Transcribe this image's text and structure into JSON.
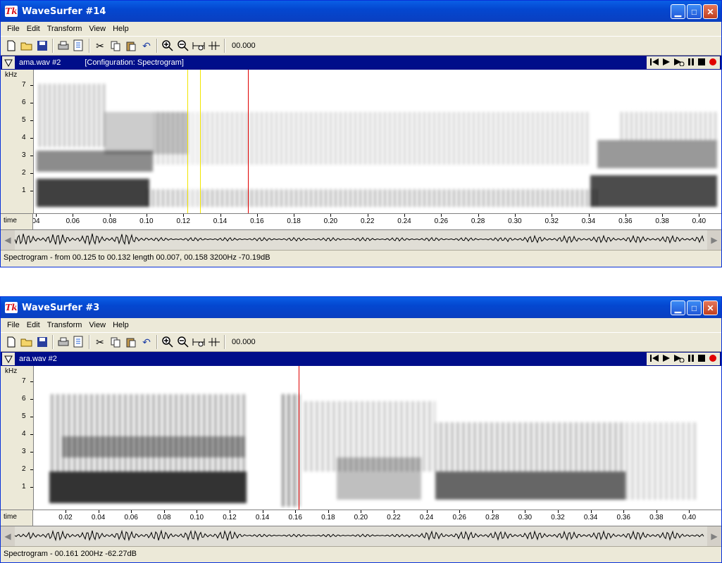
{
  "windows": [
    {
      "title": "WaveSurfer #14",
      "menu": [
        "File",
        "Edit",
        "Transform",
        "View",
        "Help"
      ],
      "toolbar_time": "00.000",
      "file": "ama.wav #2",
      "configuration": "[Configuration: Spectrogram]",
      "y_unit": "kHz",
      "y_labels": [
        "7",
        "6",
        "5",
        "4",
        "3",
        "2",
        "1"
      ],
      "time_label": "time",
      "time_labels": [
        "04",
        "0.06",
        "0.08",
        "0.10",
        "0.12",
        "0.14",
        "0.16",
        "0.18",
        "0.20",
        "0.22",
        "0.24",
        "0.26",
        "0.28",
        "0.30",
        "0.32",
        "0.34",
        "0.36",
        "0.38",
        "0.40",
        "0"
      ],
      "status": "Spectrogram - from 00.125 to 00.132 length 00.007, 00.158 3200Hz -70.19dB"
    },
    {
      "title": "WaveSurfer #3",
      "menu": [
        "File",
        "Edit",
        "Transform",
        "View",
        "Help"
      ],
      "toolbar_time": "00.000",
      "file": "ara.wav #2",
      "configuration": "",
      "y_unit": "kHz",
      "y_labels": [
        "7",
        "6",
        "5",
        "4",
        "3",
        "2",
        "1"
      ],
      "time_label": "time",
      "time_labels": [
        "0.02",
        "0.04",
        "0.06",
        "0.08",
        "0.10",
        "0.12",
        "0.14",
        "0.16",
        "0.18",
        "0.20",
        "0.22",
        "0.24",
        "0.26",
        "0.28",
        "0.30",
        "0.32",
        "0.34",
        "0.36",
        "0.38",
        "0.40"
      ],
      "status": "Spectrogram - 00.161 200Hz -62.27dB"
    }
  ],
  "icons": [
    "new-file-icon",
    "open-folder-icon",
    "save-icon",
    "print-icon",
    "properties-icon",
    "cut-icon",
    "copy-icon",
    "paste-icon",
    "undo-icon",
    "zoom-in-icon",
    "zoom-out-icon",
    "zoom-fit-icon",
    "zoom-selection-icon"
  ],
  "colors": {
    "titlebar": "#0a5fe6",
    "panelhead": "#000e8a",
    "cursor": "#e00000",
    "selection": "#f2e600",
    "record": "#e00000"
  }
}
